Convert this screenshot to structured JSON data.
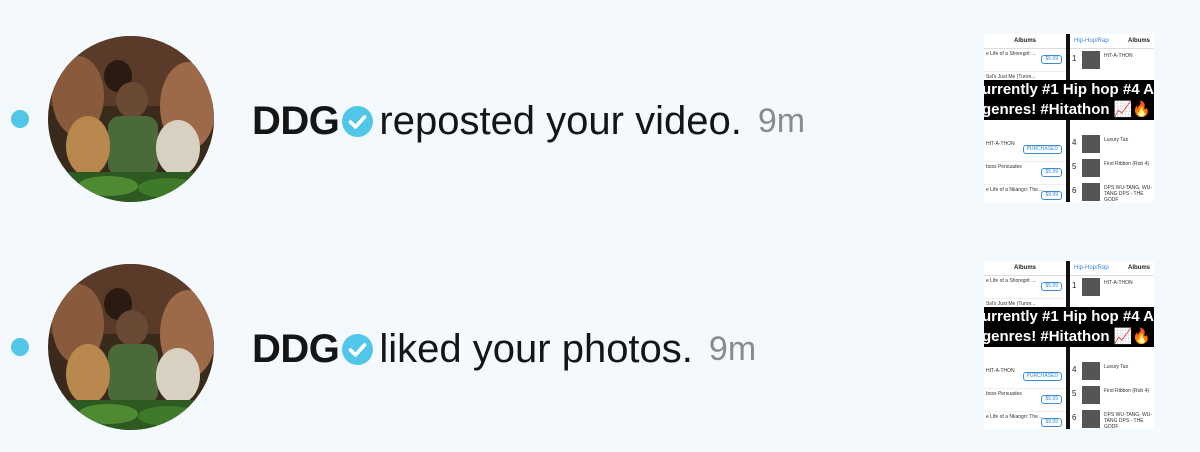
{
  "notifications": [
    {
      "username": "DDG",
      "action": "reposted your video.",
      "time": "9m",
      "thumbnail": {
        "left_header": "Albums",
        "right_back": "Hip-Hop/Rap",
        "right_header": "Albums",
        "banner_line1": "urrently #1 Hip hop #4 A",
        "banner_line2": "genres! #Hitathon 📈🔥",
        "left_items": [
          {
            "title": "e Life of a Shoregirl: ...",
            "price": "$5.99"
          },
          {
            "title": "Ssl's Just Me (Turon...",
            "price": ""
          },
          {
            "title": "HIT-A-THON",
            "price": "PURCHASED"
          },
          {
            "title": "boss Persuades",
            "price": "$5.99"
          },
          {
            "title": "e Life of a Nkangri: The ...",
            "price": "$9.99"
          }
        ],
        "right_items": [
          {
            "rank": "1",
            "title": "HIT-A-THON"
          },
          {
            "rank": "4",
            "title": "Luxury Tax"
          },
          {
            "rank": "5",
            "title": "First Ribbon (Rob 4)"
          },
          {
            "rank": "6",
            "title": "DPS WU-TANG, WU-TANG DPS - THE GODF"
          }
        ]
      }
    },
    {
      "username": "DDG",
      "action": "liked your photos.",
      "time": "9m",
      "thumbnail": {
        "left_header": "Albums",
        "right_back": "Hip-Hop/Rap",
        "right_header": "Albums",
        "banner_line1": "urrently #1 Hip hop #4 A",
        "banner_line2": "genres! #Hitathon 📈🔥",
        "left_items": [
          {
            "title": "e Life of a Shoregirl: ...",
            "price": "$5.99"
          },
          {
            "title": "Ssl's Just Me (Turon...",
            "price": ""
          },
          {
            "title": "HIT-A-THON",
            "price": "PURCHASED"
          },
          {
            "title": "boss Persuades",
            "price": "$5.99"
          },
          {
            "title": "e Life of a Nkangri: The ...",
            "price": "$9.99"
          }
        ],
        "right_items": [
          {
            "rank": "1",
            "title": "HIT-A-THON"
          },
          {
            "rank": "4",
            "title": "Luxury Tax"
          },
          {
            "rank": "5",
            "title": "First Ribbon (Rob 4)"
          },
          {
            "rank": "6",
            "title": "DPS WU-TANG, WU-TANG DPS - THE GODF"
          }
        ]
      }
    }
  ],
  "colors": {
    "background": "#f3f9fc",
    "unread_dot": "#52c6e8",
    "verified_badge": "#52c6e8",
    "username_text": "#151515",
    "time_text": "#8b8b8b"
  },
  "icons": {
    "unread": "unread-dot-icon",
    "verified": "verified-check-icon"
  }
}
